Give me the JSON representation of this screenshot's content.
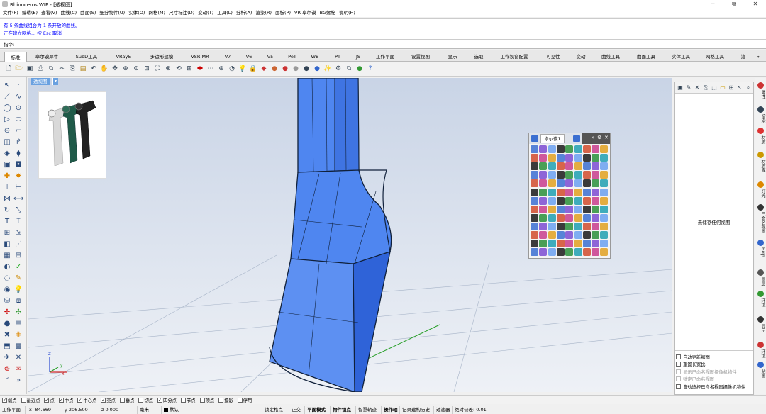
{
  "window": {
    "title": "Rhinoceros WIP - [透视图]",
    "min": "─",
    "max": "⧉",
    "close": "✕"
  },
  "menu": [
    "文件(F)",
    "编辑(E)",
    "查看(V)",
    "曲线(C)",
    "曲面(S)",
    "细分物件(U)",
    "实体(O)",
    "网格(M)",
    "尺寸标注(D)",
    "变动(T)",
    "工具(L)",
    "分析(A)",
    "渲染(R)",
    "面板(P)",
    "VR-卓尔谟",
    "BG螺栓",
    "说明(H)"
  ],
  "command_history": [
    "有 5 条曲线组合为 1 条开放的曲线。",
    "正在建立网格... 按 Esc 取消"
  ],
  "command_prompt": "指令:",
  "tabs": [
    "标准",
    "卓尔谟犀牛",
    "SubD工具",
    "VRay5",
    "多边形建模",
    "VSR-MR",
    "V7",
    "V6",
    "V5",
    "PeT",
    "WB",
    "PT",
    "JS",
    "工作平面",
    "设置视图",
    "显示",
    "选取",
    "工作视窗配置",
    "可见性",
    "变动",
    "曲线工具",
    "曲面工具",
    "实体工具",
    "网格工具",
    "渲"
  ],
  "tab_more": "»",
  "viewport": {
    "label": "透视图",
    "dropdown": "▾",
    "axis_x": "x",
    "axis_y": "y",
    "axis_z": "z"
  },
  "float_panel": {
    "tab": "卓尔谟1",
    "more": "»",
    "gear": "⚙",
    "close": "✕"
  },
  "right_panel": {
    "empty_text": "未储存任何视图",
    "options": [
      {
        "label": "自动更新缩图",
        "disabled": false
      },
      {
        "label": "重置长宽比",
        "disabled": false
      },
      {
        "label": "显示已命名视图摄像机物件",
        "disabled": true
      },
      {
        "label": "锁定已命名视图",
        "disabled": true
      },
      {
        "label": "自动选择已命名视图摄像机物件",
        "disabled": false
      }
    ]
  },
  "side_tabs": [
    "属性",
    "渲染",
    "材质",
    "材质库",
    "灯光",
    "已命名视图",
    "Help",
    "图层",
    "环境",
    "显示",
    "环境",
    "贴图"
  ],
  "osnaps": [
    {
      "label": "端点",
      "checked": true
    },
    {
      "label": "最近点",
      "checked": false
    },
    {
      "label": "点",
      "checked": true
    },
    {
      "label": "中点",
      "checked": true
    },
    {
      "label": "中心点",
      "checked": true
    },
    {
      "label": "交点",
      "checked": true
    },
    {
      "label": "垂点",
      "checked": false
    },
    {
      "label": "切点",
      "checked": false
    },
    {
      "label": "四分点",
      "checked": true
    },
    {
      "label": "节点",
      "checked": false
    },
    {
      "label": "顶点",
      "checked": false
    },
    {
      "label": "投影",
      "checked": false
    },
    {
      "label": "停用",
      "checked": false
    }
  ],
  "status": {
    "cplane": "工作平面",
    "x": "x -84.669",
    "y": "y 206.500",
    "z": "z 0.000",
    "units": "毫米",
    "layer": "默认",
    "grid_snap": "锁定格点",
    "ortho": "正交",
    "planar": "平面模式",
    "osnap": "物件锁点",
    "smart_track": "智慧轨迹",
    "gumball": "操作轴",
    "history": "记录建构历史",
    "filter": "过滤器",
    "tolerance": "绝对公差: 0.01"
  }
}
